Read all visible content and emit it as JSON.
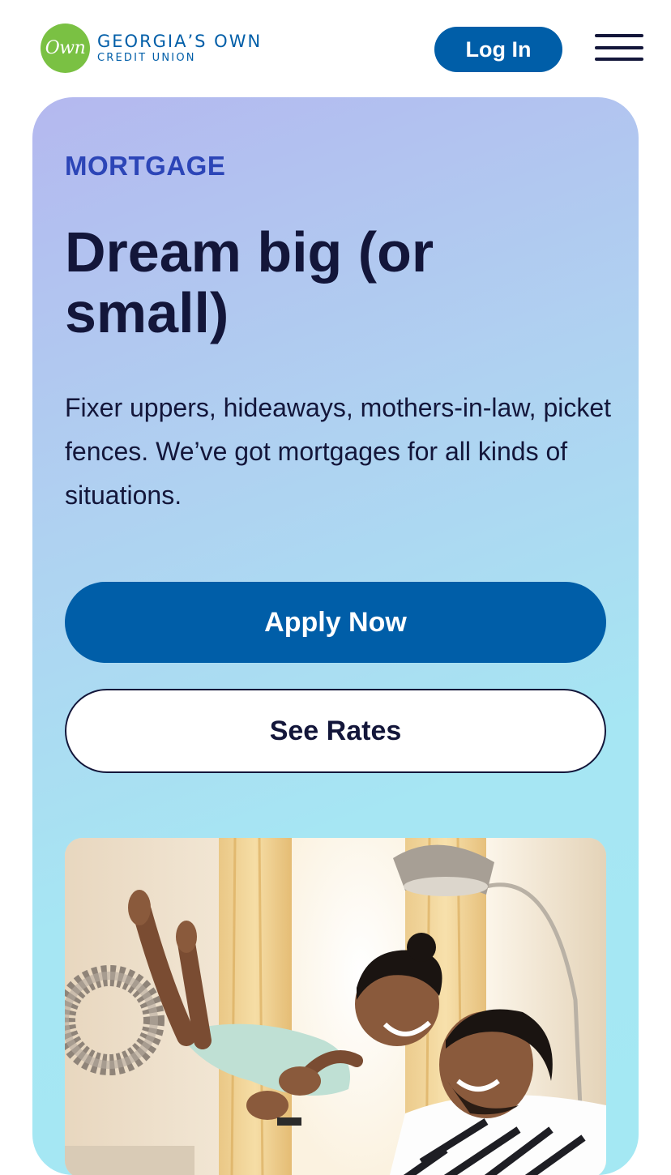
{
  "header": {
    "logo_badge": "Own",
    "logo_line1": "GEORGIA’S OWN",
    "logo_line2": "CREDIT UNION",
    "login_label": "Log In",
    "menu_icon": "hamburger-menu-icon"
  },
  "hero": {
    "eyebrow": "MORTGAGE",
    "headline": "Dream big (or small)",
    "body": "Fixer uppers, hideaways, mothers-in-law, picket fences. We’ve got mortgages for all kinds of situations.",
    "apply_label": "Apply Now",
    "rates_label": "See Rates",
    "photo": "father-lifting-daughter-photo"
  },
  "colors": {
    "brand_blue": "#005ea8",
    "brand_green": "#7ac143",
    "navy_text": "#13163a",
    "eyebrow_blue": "#2c45b7"
  }
}
